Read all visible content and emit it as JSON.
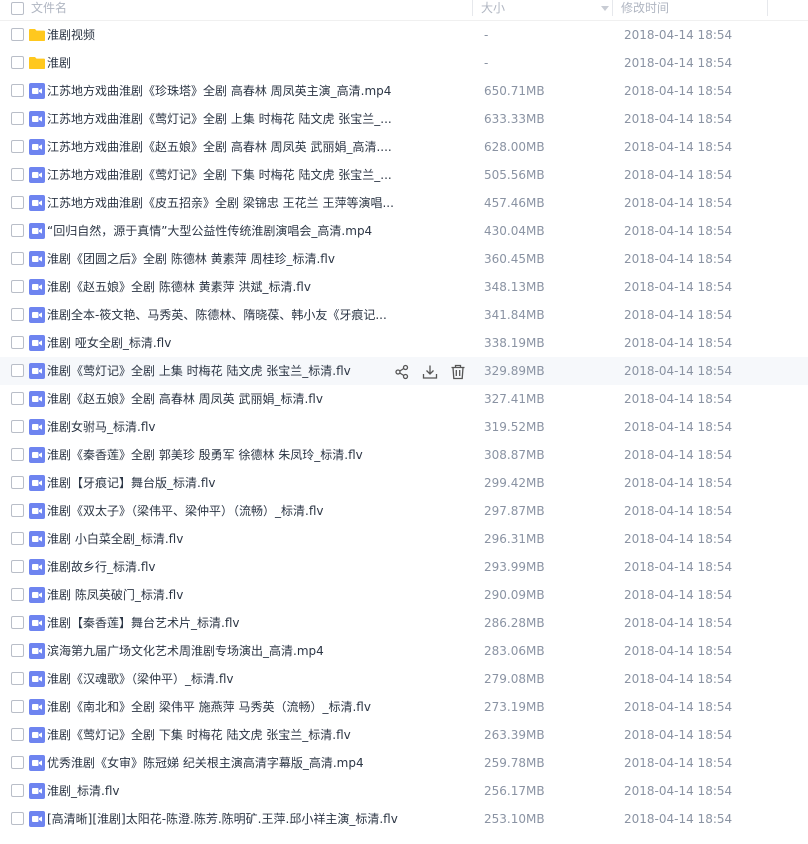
{
  "header": {
    "name_label": "文件名",
    "size_label": "大小",
    "date_label": "修改时间"
  },
  "colors": {
    "folder": "#ffc81e",
    "video": "#6e84f0",
    "hover_row": "#f6f8fb"
  },
  "rows": [
    {
      "type": "folder",
      "name": "淮剧视频",
      "size": "-",
      "date": "2018-04-14 18:54"
    },
    {
      "type": "folder",
      "name": "淮剧",
      "size": "-",
      "date": "2018-04-14 18:54"
    },
    {
      "type": "video",
      "name": "江苏地方戏曲淮剧《珍珠塔》全剧 高春林 周凤英主演_高清.mp4",
      "size": "650.71MB",
      "date": "2018-04-14 18:54"
    },
    {
      "type": "video",
      "name": "江苏地方戏曲淮剧《莺灯记》全剧 上集 时梅花 陆文虎 张宝兰_...",
      "size": "633.33MB",
      "date": "2018-04-14 18:54"
    },
    {
      "type": "video",
      "name": "江苏地方戏曲淮剧《赵五娘》全剧  高春林 周凤英 武丽娟_高清....",
      "size": "628.00MB",
      "date": "2018-04-14 18:54"
    },
    {
      "type": "video",
      "name": "江苏地方戏曲淮剧《莺灯记》全剧 下集 时梅花 陆文虎 张宝兰_...",
      "size": "505.56MB",
      "date": "2018-04-14 18:54"
    },
    {
      "type": "video",
      "name": "江苏地方戏曲淮剧《皮五招亲》全剧 梁锦忠 王花兰 王萍等演唱...",
      "size": "457.46MB",
      "date": "2018-04-14 18:54"
    },
    {
      "type": "video",
      "name": "“回归自然，源于真情”大型公益性传统淮剧演唱会_高清.mp4",
      "size": "430.04MB",
      "date": "2018-04-14 18:54"
    },
    {
      "type": "video",
      "name": "淮剧《团圆之后》全剧 陈德林 黄素萍 周桂珍_标清.flv",
      "size": "360.45MB",
      "date": "2018-04-14 18:54"
    },
    {
      "type": "video",
      "name": "淮剧《赵五娘》全剧 陈德林 黄素萍 洪斌_标清.flv",
      "size": "348.13MB",
      "date": "2018-04-14 18:54"
    },
    {
      "type": "video",
      "name": "淮剧全本-筱文艳、马秀英、陈德林、隋晓葆、韩小友《牙痕记...",
      "size": "341.84MB",
      "date": "2018-04-14 18:54"
    },
    {
      "type": "video",
      "name": "淮剧 哑女全剧_标清.flv",
      "size": "338.19MB",
      "date": "2018-04-14 18:54"
    },
    {
      "type": "video",
      "name": "淮剧《莺灯记》全剧 上集 时梅花 陆文虎 张宝兰_标清.flv",
      "size": "329.89MB",
      "date": "2018-04-14 18:54",
      "hover": true
    },
    {
      "type": "video",
      "name": "淮剧《赵五娘》全剧 高春林 周凤英 武丽娟_标清.flv",
      "size": "327.41MB",
      "date": "2018-04-14 18:54"
    },
    {
      "type": "video",
      "name": "淮剧女驸马_标清.flv",
      "size": "319.52MB",
      "date": "2018-04-14 18:54"
    },
    {
      "type": "video",
      "name": "淮剧《秦香莲》全剧 郭美珍 殷勇军 徐德林 朱凤玲_标清.flv",
      "size": "308.87MB",
      "date": "2018-04-14 18:54"
    },
    {
      "type": "video",
      "name": "淮剧【牙痕记】舞台版_标清.flv",
      "size": "299.42MB",
      "date": "2018-04-14 18:54"
    },
    {
      "type": "video",
      "name": "淮剧《双太子》（梁伟平、梁仲平）（流畅）_标清.flv",
      "size": "297.87MB",
      "date": "2018-04-14 18:54"
    },
    {
      "type": "video",
      "name": "淮剧 小白菜全剧_标清.flv",
      "size": "296.31MB",
      "date": "2018-04-14 18:54"
    },
    {
      "type": "video",
      "name": "淮剧故乡行_标清.flv",
      "size": "293.99MB",
      "date": "2018-04-14 18:54"
    },
    {
      "type": "video",
      "name": "淮剧 陈凤英破门_标清.flv",
      "size": "290.09MB",
      "date": "2018-04-14 18:54"
    },
    {
      "type": "video",
      "name": "淮剧【秦香莲】舞台艺术片_标清.flv",
      "size": "286.28MB",
      "date": "2018-04-14 18:54"
    },
    {
      "type": "video",
      "name": "滨海第九届广场文化艺术周淮剧专场演出_高清.mp4",
      "size": "283.06MB",
      "date": "2018-04-14 18:54"
    },
    {
      "type": "video",
      "name": "淮剧《汉魂歌》（梁仲平）_标清.flv",
      "size": "279.08MB",
      "date": "2018-04-14 18:54"
    },
    {
      "type": "video",
      "name": "淮剧《南北和》全剧 梁伟平 施燕萍 马秀英（流畅）_标清.flv",
      "size": "273.19MB",
      "date": "2018-04-14 18:54"
    },
    {
      "type": "video",
      "name": "淮剧《莺灯记》全剧 下集 时梅花 陆文虎 张宝兰_标清.flv",
      "size": "263.39MB",
      "date": "2018-04-14 18:54"
    },
    {
      "type": "video",
      "name": "优秀淮剧《女审》陈冠娣 纪关根主演高清字幕版_高清.mp4",
      "size": "259.78MB",
      "date": "2018-04-14 18:54"
    },
    {
      "type": "video",
      "name": "淮剧_标清.flv",
      "size": "256.17MB",
      "date": "2018-04-14 18:54"
    },
    {
      "type": "video",
      "name": "[高清晰][淮剧]太阳花-陈澄.陈芳.陈明矿.王萍.邱小祥主演_标清.flv",
      "size": "253.10MB",
      "date": "2018-04-14 18:54"
    }
  ]
}
